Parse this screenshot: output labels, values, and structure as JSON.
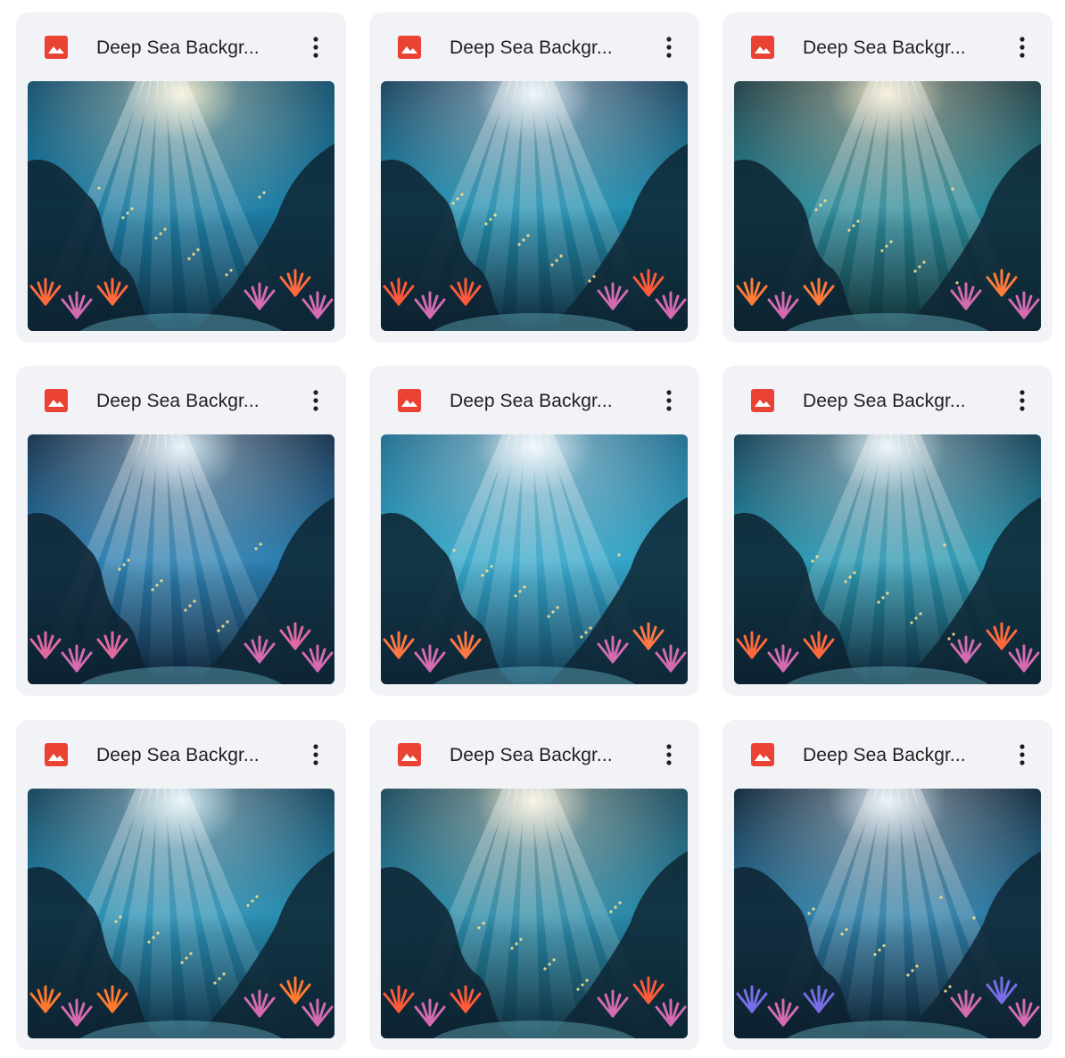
{
  "files": [
    {
      "name": "Deep Sea Backgr...",
      "file_type_icon": "image-file-icon",
      "menu_icon": "more-vert-icon",
      "palette": {
        "top": "#0e4b6b",
        "mid": "#1e7fa6",
        "bottom": "#0b2a3d",
        "light": "#fff7d6",
        "coral": "#ff6a3d"
      }
    },
    {
      "name": "Deep Sea Backgr...",
      "file_type_icon": "image-file-icon",
      "menu_icon": "more-vert-icon",
      "palette": {
        "top": "#163f5c",
        "mid": "#2490b0",
        "bottom": "#0a2433",
        "light": "#f2fbff",
        "coral": "#ff5a3a"
      }
    },
    {
      "name": "Deep Sea Backgr...",
      "file_type_icon": "image-file-icon",
      "menu_icon": "more-vert-icon",
      "palette": {
        "top": "#1b3b44",
        "mid": "#2b8a9a",
        "bottom": "#0c2a2e",
        "light": "#fff2d2",
        "coral": "#ff7b3a"
      }
    },
    {
      "name": "Deep Sea Backgr...",
      "file_type_icon": "image-file-icon",
      "menu_icon": "more-vert-icon",
      "palette": {
        "top": "#122c48",
        "mid": "#2c7fb0",
        "bottom": "#0d1f33",
        "light": "#e6f6ff",
        "coral": "#e06aa0"
      }
    },
    {
      "name": "Deep Sea Backgr...",
      "file_type_icon": "image-file-icon",
      "menu_icon": "more-vert-icon",
      "palette": {
        "top": "#1a6a8c",
        "mid": "#35a6c8",
        "bottom": "#0e3650",
        "light": "#f6fbff",
        "coral": "#ff7744"
      }
    },
    {
      "name": "Deep Sea Backgr...",
      "file_type_icon": "image-file-icon",
      "menu_icon": "more-vert-icon",
      "palette": {
        "top": "#0f3c52",
        "mid": "#2b97b0",
        "bottom": "#0a2232",
        "light": "#f0fbff",
        "coral": "#ff6a3d"
      }
    },
    {
      "name": "Deep Sea Backgr...",
      "file_type_icon": "image-file-icon",
      "menu_icon": "more-vert-icon",
      "palette": {
        "top": "#0f3d56",
        "mid": "#2a8fb2",
        "bottom": "#0b2a3e",
        "light": "#e8fbff",
        "coral": "#ff7a2e"
      }
    },
    {
      "name": "Deep Sea Backgr...",
      "file_type_icon": "image-file-icon",
      "menu_icon": "more-vert-icon",
      "palette": {
        "top": "#17475c",
        "mid": "#2a8aa8",
        "bottom": "#0c2b38",
        "light": "#fff6dc",
        "coral": "#ff5a3a"
      }
    },
    {
      "name": "Deep Sea Backgr...",
      "file_type_icon": "image-file-icon",
      "menu_icon": "more-vert-icon",
      "palette": {
        "top": "#0d2438",
        "mid": "#2f7ea6",
        "bottom": "#0a1a2a",
        "light": "#eef8ff",
        "coral": "#7a6ee6"
      }
    }
  ]
}
